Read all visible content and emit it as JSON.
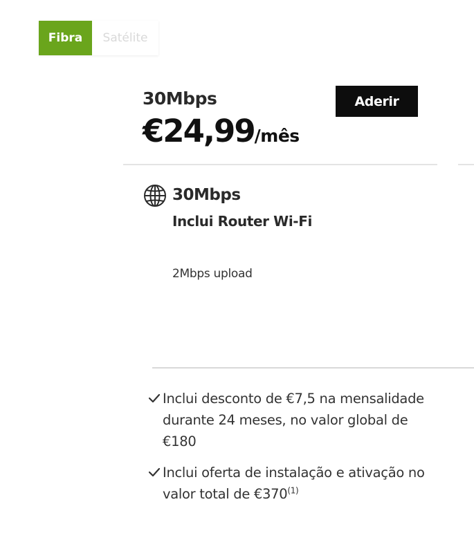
{
  "tabs": [
    {
      "label": "Fibra",
      "active": true
    },
    {
      "label": "Satélite",
      "active": false
    }
  ],
  "plan": {
    "speed_title": "30Mbps",
    "price": "€24,99",
    "period": "/mês",
    "join_label": "Aderir"
  },
  "features": {
    "icon": "globe-icon",
    "speed": "30Mbps",
    "router": "Inclui Router Wi-Fi",
    "upload": "2Mbps upload"
  },
  "benefits": [
    {
      "icon": "check-icon",
      "text": "Inclui desconto de €7,5 na mensalidade durante 24 meses, no valor global de €180",
      "footnote": ""
    },
    {
      "icon": "check-icon",
      "text": "Inclui oferta de instalação e ativação no valor total de €370",
      "footnote": "(1)"
    }
  ],
  "colors": {
    "accent": "#6aa51c",
    "button": "#0d0d0d",
    "inactive_tab_text": "#d9d9d9"
  }
}
